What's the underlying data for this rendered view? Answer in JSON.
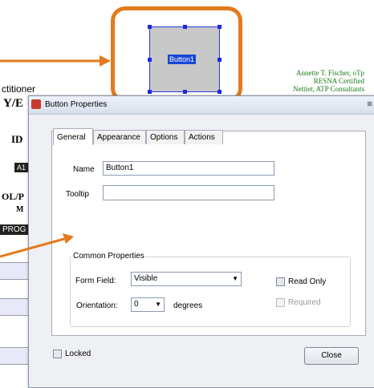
{
  "background": {
    "partial_texts": [
      "ctitioner",
      "Y/E",
      "ID",
      "A1",
      "OL/P",
      "M",
      "PROG"
    ],
    "signature_block": {
      "name": "Annette T. Fischer, oTp",
      "cert": "RESNA Certified",
      "org": "Nettiet, ATP Consultants"
    },
    "form_button_label": "Button1"
  },
  "dialog": {
    "title": "Button Properties",
    "tabs": [
      {
        "label": "General",
        "active": true
      },
      {
        "label": "Appearance",
        "active": false
      },
      {
        "label": "Options",
        "active": false
      },
      {
        "label": "Actions",
        "active": false
      }
    ],
    "name_label": "Name",
    "name_value": "Button1",
    "tooltip_label": "Tooltip",
    "tooltip_value": "",
    "common_properties_title": "Common Properties",
    "form_field_label": "Form Field:",
    "form_field_value": "Visible",
    "read_only_label": "Read Only",
    "orientation_label": "Orientation:",
    "orientation_value": "0",
    "degrees_label": "degrees",
    "required_label": "Required",
    "locked_label": "Locked",
    "close_label": "Close"
  },
  "colors": {
    "highlight_orange": "#e37a1d",
    "selection_blue": "#1d2ae0"
  }
}
